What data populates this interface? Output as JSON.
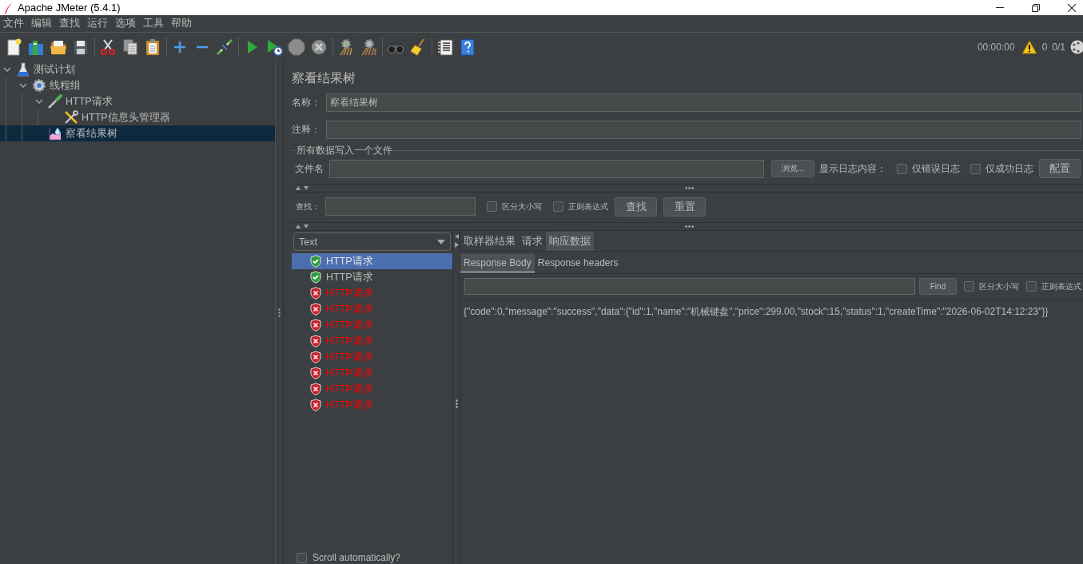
{
  "window": {
    "title": "Apache JMeter (5.4.1)"
  },
  "menu": [
    "文件",
    "编辑",
    "查找",
    "运行",
    "选项",
    "工具",
    "帮助"
  ],
  "toolbar": {
    "elapsed": "00:00:00",
    "warnings": "0",
    "threads": "0/1"
  },
  "tree": [
    {
      "label": "测试计划",
      "kind": "plan",
      "expanded": true,
      "selected": false,
      "children": [
        {
          "label": "线程组",
          "kind": "thread-group",
          "expanded": true,
          "selected": false,
          "children": [
            {
              "label": "HTTP请求",
              "kind": "sampler",
              "expanded": true,
              "selected": false,
              "children": [
                {
                  "label": "HTTP信息头管理器",
                  "kind": "config",
                  "selected": false
                }
              ]
            },
            {
              "label": "察看结果树",
              "kind": "listener",
              "selected": true
            }
          ]
        }
      ]
    }
  ],
  "panel": {
    "title": "察看结果树",
    "name_label": "名称：",
    "name_value": "察看结果树",
    "comment_label": "注释：",
    "file_group": {
      "legend": "所有数据写入一个文件",
      "file_label": "文件名",
      "browse_button": "浏览...",
      "log_label": "显示日志内容：",
      "log_options": [
        {
          "label": "仅错误日志",
          "checked": false
        },
        {
          "label": "仅成功日志",
          "checked": false
        }
      ],
      "config_button": "配置"
    },
    "search": {
      "label": "查找：",
      "options": [
        {
          "label": "区分大小写",
          "checked": false
        },
        {
          "label": "正则表达式",
          "checked": false
        }
      ],
      "find_button": "查找",
      "reset_button": "重置"
    }
  },
  "renderer": "Text",
  "results": [
    {
      "label": "HTTP请求",
      "success": true,
      "selected": true
    },
    {
      "label": "HTTP请求",
      "success": true,
      "selected": false
    },
    {
      "label": "HTTP请求",
      "success": false,
      "selected": false
    },
    {
      "label": "HTTP请求",
      "success": false,
      "selected": false
    },
    {
      "label": "HTTP请求",
      "success": false,
      "selected": false
    },
    {
      "label": "HTTP请求",
      "success": false,
      "selected": false
    },
    {
      "label": "HTTP请求",
      "success": false,
      "selected": false
    },
    {
      "label": "HTTP请求",
      "success": false,
      "selected": false
    },
    {
      "label": "HTTP请求",
      "success": false,
      "selected": false
    },
    {
      "label": "HTTP请求",
      "success": false,
      "selected": false
    }
  ],
  "scroll_automatically": {
    "label": "Scroll automatically?",
    "checked": false
  },
  "tabs": [
    {
      "label": "取样器结果",
      "selected": false
    },
    {
      "label": "请求",
      "selected": false
    },
    {
      "label": "响应数据",
      "selected": true
    }
  ],
  "subtabs": [
    {
      "label": "Response Body",
      "selected": true
    },
    {
      "label": "Response headers",
      "selected": false
    }
  ],
  "response_search": {
    "find_button": "Find",
    "options": [
      {
        "label": "区分大小写",
        "checked": false
      },
      {
        "label": "正则表达式",
        "checked": false
      }
    ]
  },
  "response_body": "{\"code\":0,\"message\":\"success\",\"data\":{\"id\":1,\"name\":\"机械键盘\",\"price\":299.00,\"stock\":15,\"status\":1,\"createTime\":\"2026-06-02T14:12:23\"}}"
}
